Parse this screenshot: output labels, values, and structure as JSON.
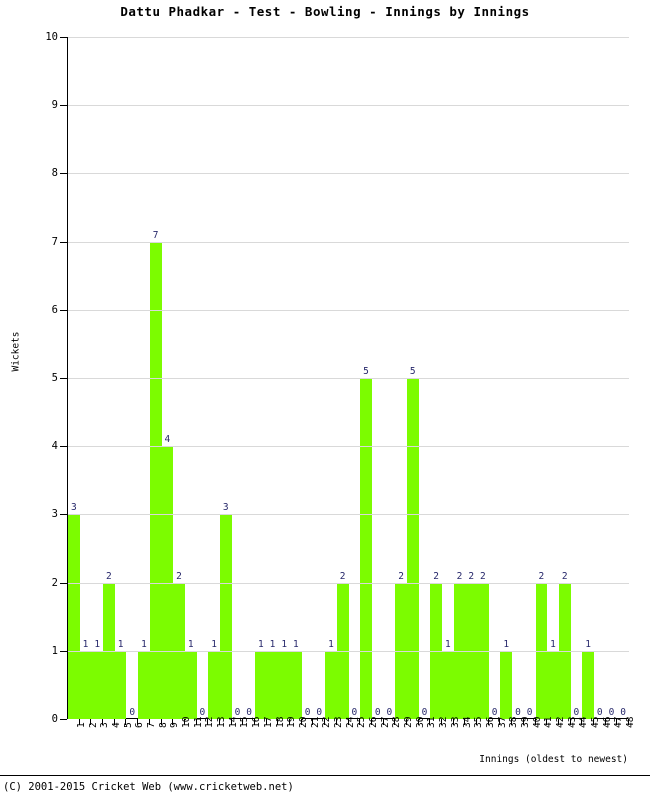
{
  "chart_data": {
    "type": "bar",
    "title": "Dattu Phadkar - Test - Bowling - Innings by Innings",
    "xlabel": "Innings (oldest to newest)",
    "ylabel": "Wickets",
    "ylim": [
      0,
      10
    ],
    "ytick_step": 1,
    "grid": true,
    "legend": null,
    "bar_color": "#7cfc00",
    "label_color": "#27286b",
    "categories": [
      "1",
      "2",
      "3",
      "4",
      "5",
      "6",
      "7",
      "8",
      "9",
      "10",
      "11",
      "12",
      "13",
      "14",
      "15",
      "16",
      "17",
      "18",
      "19",
      "20",
      "21",
      "22",
      "23",
      "24",
      "25",
      "26",
      "27",
      "28",
      "29",
      "30",
      "31",
      "32",
      "33",
      "34",
      "35",
      "36",
      "37",
      "38",
      "39",
      "40",
      "41",
      "42",
      "43",
      "44",
      "45",
      "46",
      "47",
      "48"
    ],
    "values": [
      3,
      1,
      1,
      2,
      1,
      0,
      1,
      7,
      4,
      2,
      1,
      0,
      1,
      3,
      0,
      0,
      1,
      1,
      1,
      1,
      0,
      0,
      1,
      2,
      0,
      5,
      0,
      0,
      2,
      5,
      0,
      2,
      1,
      2,
      2,
      2,
      0,
      1,
      0,
      0,
      2,
      1,
      2,
      0,
      1,
      0,
      0,
      0
    ],
    "yticks": [
      "0",
      "1",
      "2",
      "3",
      "4",
      "5",
      "6",
      "7",
      "8",
      "9",
      "10"
    ]
  },
  "footer": {
    "copyright": "(C) 2001-2015 Cricket Web (www.cricketweb.net)"
  }
}
